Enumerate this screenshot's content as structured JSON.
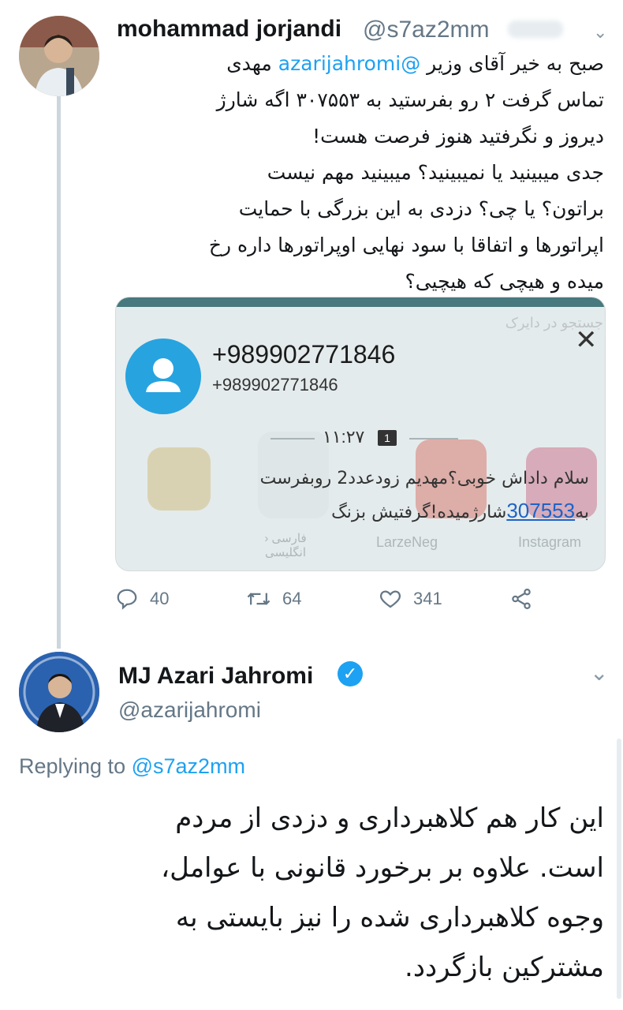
{
  "tweet1": {
    "author_name": "mohammad jorjandi",
    "author_handle": "@s7az2mm",
    "mention": "@azarijahromi",
    "lines": [
      "صبح به خیر آقای وزیر",
      "مهدی",
      "تماس گرفت ۲ رو بفرستید به ۳۰۷۵۵۳ اگه شارژ",
      "دیروز و نگرفتید هنوز فرصت هست!",
      "جدی میبینید یا نمیبینید؟ میبینید مهم نیست",
      "براتون؟ یا چی؟ دزدی به این بزرگی با حمایت",
      "اپراتورها و اتفاقا با سود نهایی اوپراتورها داره رخ",
      "میده و هیچی که هیچیی؟"
    ],
    "screenshot": {
      "search_placeholder": "جستجو در دایرک",
      "close_glyph": "✕",
      "phone_title": "+989902771846",
      "phone_subtitle": "+989902771846",
      "time": "۱۱:۲۷",
      "sim": "1",
      "message_line1": "سلام داداش خوبی؟مهدیم زودعدد2 روبفرست",
      "message_prefix": "به",
      "message_link": "307553",
      "message_suffix": "شارژمیده!گرفتیش بزنگ",
      "bg_label_1": "Instagram",
      "bg_label_2": "LarzeNeg",
      "bg_label_3": "فارسی ‹ انگلیسی"
    },
    "actions": {
      "replies": "40",
      "retweets": "64",
      "likes": "341"
    }
  },
  "tweet2": {
    "author_name": "MJ Azari Jahromi",
    "author_handle": "@azarijahromi",
    "replying_prefix": "Replying to",
    "replying_to": "@s7az2mm",
    "lines": [
      "این کار هم کلاهبرداری و دزدی از مردم",
      "است. علاوه بر برخورد قانونی با عوامل،",
      "وجوه کلاهبرداری شده را نیز بایستی به",
      "مشترکین بازگردد."
    ]
  },
  "colors": {
    "accent": "#1da1f2",
    "muted": "#657786",
    "thread_line": "#ccd6dd"
  }
}
